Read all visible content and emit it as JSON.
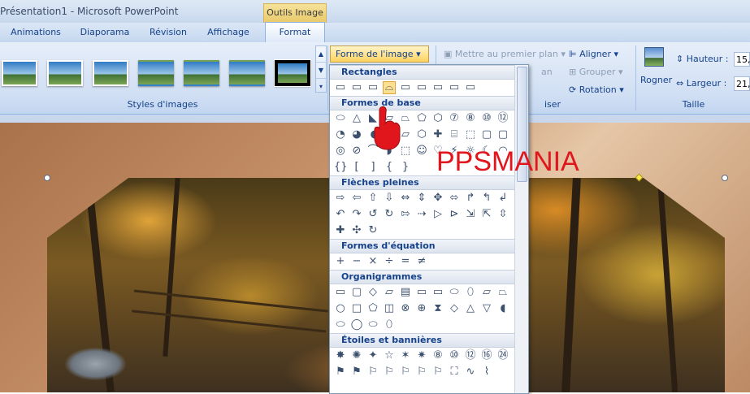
{
  "window": {
    "title": "Présentation1 - Microsoft PowerPoint",
    "context_tab_header": "Outils Image"
  },
  "tabs": [
    {
      "label": "Animations",
      "active": false
    },
    {
      "label": "Diaporama",
      "active": false
    },
    {
      "label": "Révision",
      "active": false
    },
    {
      "label": "Affichage",
      "active": false
    },
    {
      "label": "Format",
      "active": true
    }
  ],
  "ribbon": {
    "styles_group_label": "Styles d'images",
    "picture_shape_button": "Forme de l'image",
    "bring_front": "Mettre au premier plan",
    "align": "Aligner",
    "group": "Grouper",
    "rotation": "Rotation",
    "crop": "Rogner",
    "height_label": "Hauteur :",
    "height_value": "15,",
    "width_label": "Largeur :",
    "width_value": "21,",
    "size_group_label": "Taille",
    "arrange_partial": "iser",
    "hidden_partial": "an"
  },
  "gallery": {
    "categories": [
      {
        "label": "Rectangles",
        "rows": [
          [
            "▭",
            "▭",
            "▭",
            "⌓",
            "▭",
            "▭",
            "▭",
            "▭",
            "▭"
          ]
        ]
      },
      {
        "label": "Formes de base",
        "rows": [
          [
            "⬭",
            "△",
            "◣",
            "▱",
            "⏢",
            "⬠",
            "⬡",
            "⑦",
            "⑧",
            "⑩",
            "⑫"
          ],
          [
            "◔",
            "◕",
            "◖",
            "⌜",
            "▱",
            "⬡",
            "✚",
            "⌸",
            "⬚",
            "▢",
            "▢"
          ],
          [
            "◎",
            "⊘",
            "⌒",
            "◗",
            "⬚",
            "☺",
            "♡",
            "⚡",
            "☼",
            "☾",
            "◠"
          ],
          [
            "{}",
            "[",
            "]",
            "{",
            "}"
          ]
        ]
      },
      {
        "label": "Flèches pleines",
        "rows": [
          [
            "⇨",
            "⇦",
            "⇧",
            "⇩",
            "⇔",
            "⇕",
            "✥",
            "⬄",
            "↱",
            "↰",
            "↲"
          ],
          [
            "↶",
            "↷",
            "↺",
            "↻",
            "⇰",
            "⇢",
            "▷",
            "⊳",
            "⇲",
            "⇱",
            "⇳"
          ],
          [
            "✚",
            "✣",
            "↻"
          ]
        ]
      },
      {
        "label": "Formes d'équation",
        "rows": [
          [
            "+",
            "−",
            "×",
            "÷",
            "=",
            "≠"
          ]
        ]
      },
      {
        "label": "Organigrammes",
        "rows": [
          [
            "▭",
            "▢",
            "◇",
            "▱",
            "▤",
            "▭",
            "▭",
            "⬭",
            "⬯",
            "▱",
            "⏢"
          ],
          [
            "○",
            "□",
            "⬠",
            "◫",
            "⊗",
            "⊕",
            "⧗",
            "◇",
            "△",
            "▽",
            "◖"
          ],
          [
            "⬭",
            "◯",
            "⬭",
            "⬯"
          ]
        ]
      },
      {
        "label": "Étoiles et bannières",
        "rows": [
          [
            "✸",
            "✺",
            "✦",
            "☆",
            "✶",
            "✷",
            "⑧",
            "⑩",
            "⑫",
            "⑯",
            "㉔",
            "㉜"
          ],
          [
            "⚑",
            "⚑",
            "⚐",
            "⚐",
            "⚐",
            "⚐",
            "⚐",
            "⛶",
            "∿",
            "⌇"
          ]
        ]
      }
    ]
  },
  "watermark": "PPSMANIA",
  "colors": {
    "accent": "#15428b",
    "watermark": "#e0161c",
    "selected_shape": "#ffe08f"
  }
}
